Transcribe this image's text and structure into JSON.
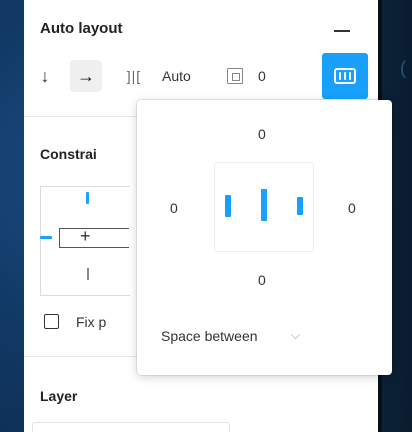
{
  "auto_layout": {
    "title": "Auto layout",
    "collapse_icon": "minus-icon",
    "direction_down_icon": "arrow-down-icon",
    "direction_right_icon": "arrow-right-icon",
    "spacing_icon": "spacing-between-icon",
    "spacing_value": "Auto",
    "padding_icon": "padding-icon",
    "padding_value": "0",
    "alignment_icon": "alignment-icon"
  },
  "constraints": {
    "title": "Constrai",
    "fix_label": "Fix p"
  },
  "alignment_popover": {
    "padding_top": "0",
    "padding_left": "0",
    "padding_right": "0",
    "padding_bottom": "0",
    "distribution_label": "Space between",
    "dropdown_icon": "chevron-down-icon"
  },
  "layer": {
    "title": "Layer"
  },
  "colors": {
    "accent": "#18a0fb"
  }
}
